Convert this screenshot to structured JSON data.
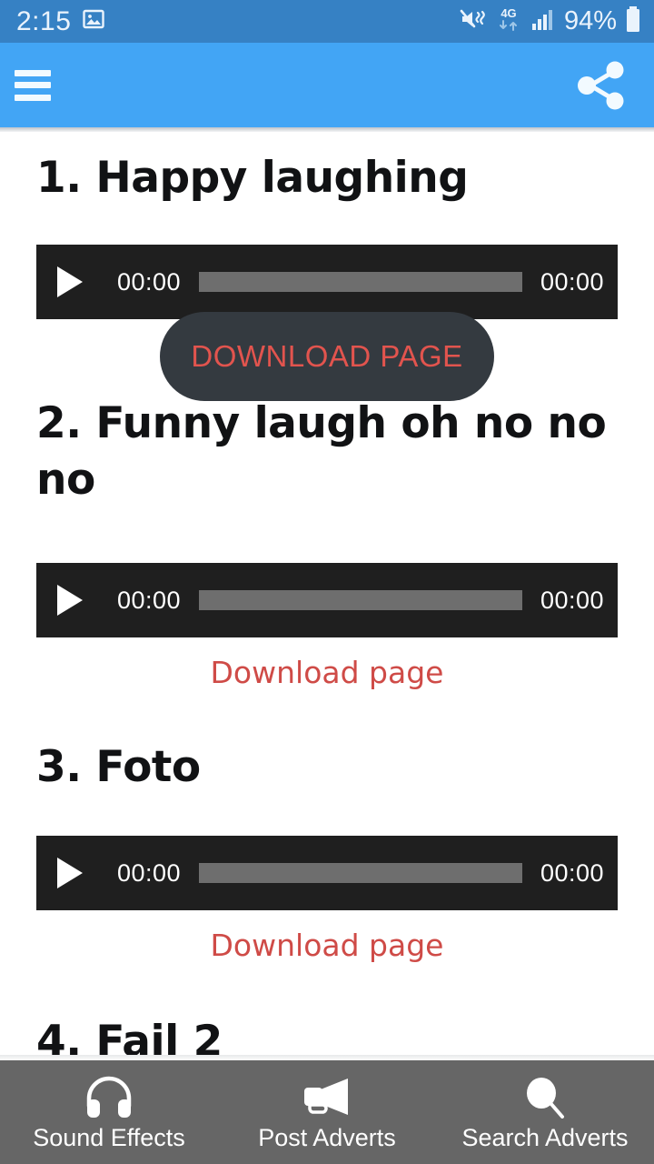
{
  "status_bar": {
    "time": "2:15",
    "battery_percent": "94%",
    "network": "4G",
    "icons": [
      "photo-icon",
      "mute-vibrate-icon",
      "network-4g-icon",
      "signal-bars-icon",
      "battery-icon"
    ]
  },
  "app_bar": {
    "menu_icon": "hamburger-menu-icon",
    "share_icon": "share-icon",
    "background_color": "#42a5f5"
  },
  "colors": {
    "status_bar": "#3681c4",
    "app_bar": "#42a5f5",
    "player_bg": "#1f1f1f",
    "progress": "#6e6e6e",
    "link_red": "#cf4b47",
    "pill_bg": "#343a40",
    "pill_text": "#e2544e",
    "bottom_nav": "#666666"
  },
  "tracks": [
    {
      "title": "1. Happy laughing",
      "player": {
        "current_time": "00:00",
        "duration": "00:00",
        "play_icon": "play-icon"
      },
      "download": {
        "label": "DOWNLOAD PAGE",
        "style": "pill"
      }
    },
    {
      "title": "2. Funny laugh oh no no no",
      "player": {
        "current_time": "00:00",
        "duration": "00:00",
        "play_icon": "play-icon"
      },
      "download": {
        "label": "Download page",
        "style": "link"
      }
    },
    {
      "title": "3. Foto",
      "player": {
        "current_time": "00:00",
        "duration": "00:00",
        "play_icon": "play-icon"
      },
      "download": {
        "label": "Download page",
        "style": "link"
      }
    },
    {
      "title": "4. Fail 2"
    }
  ],
  "bottom_nav": {
    "items": [
      {
        "label": "Sound Effects",
        "icon": "headphones-icon"
      },
      {
        "label": "Post Adverts",
        "icon": "megaphone-icon"
      },
      {
        "label": "Search Adverts",
        "icon": "search-icon"
      }
    ]
  }
}
